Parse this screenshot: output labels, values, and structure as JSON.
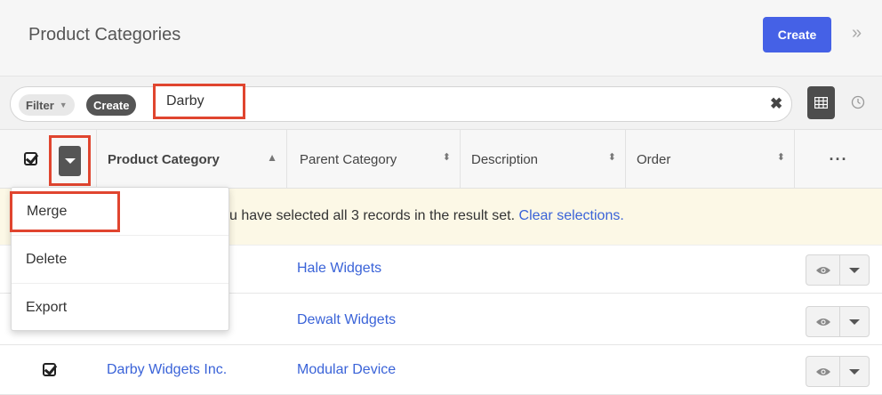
{
  "header": {
    "title": "Product Categories",
    "create_label": "Create"
  },
  "filter": {
    "filter_label": "Filter",
    "create_label": "Create",
    "query": "Darby"
  },
  "columns": [
    "Product Category",
    "Parent Category",
    "Description",
    "Order"
  ],
  "alert": {
    "text": "u have selected all 3 records in the result set. ",
    "link": "Clear selections."
  },
  "menu": {
    "merge": "Merge",
    "delete": "Delete",
    "export": "Export"
  },
  "rows": [
    {
      "product_category": "",
      "parent_category": "Hale Widgets"
    },
    {
      "product_category": "",
      "parent_category": "Dewalt Widgets"
    },
    {
      "product_category": "Darby Widgets Inc.",
      "parent_category": "Modular Device"
    }
  ],
  "colors": {
    "accent": "#4561e6",
    "highlight": "#e0452f",
    "link": "#3a63d8"
  }
}
